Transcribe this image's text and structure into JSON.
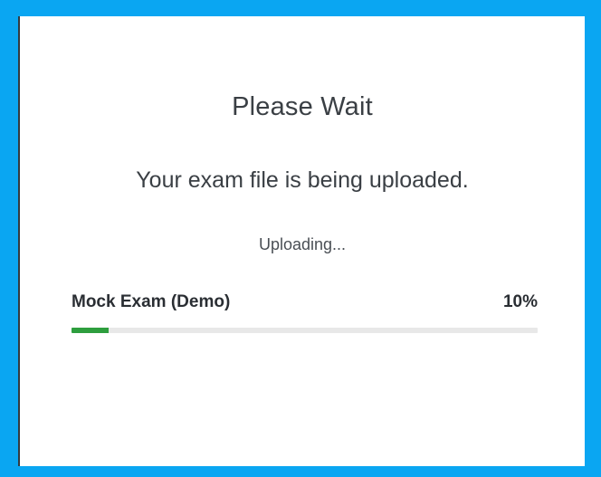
{
  "dialog": {
    "title": "Please Wait",
    "message": "Your exam file is being uploaded.",
    "status": "Uploading..."
  },
  "upload": {
    "file_name": "Mock Exam (Demo)",
    "percent_label": "10%",
    "progress": 0.08
  },
  "colors": {
    "frame": "#0aa6f2",
    "progress_fill": "#2e9e3e",
    "progress_track": "#e8e8e8"
  }
}
